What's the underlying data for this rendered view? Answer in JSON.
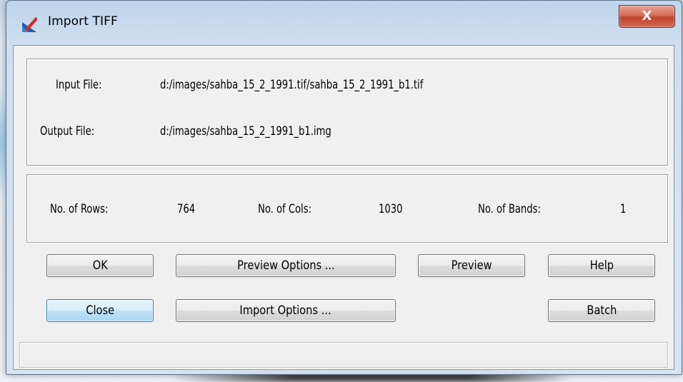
{
  "window": {
    "title": "Import TIFF",
    "close_glyph": "X",
    "icon": "erdas-app-icon"
  },
  "files": {
    "input_label": "Input File:",
    "input_value": "d:/images/sahba_15_2_1991.tif/sahba_15_2_1991_b1.tif",
    "output_label": "Output File:",
    "output_value": "d:/images/sahba_15_2_1991_b1.img"
  },
  "dimensions": {
    "rows_label": "No. of Rows:",
    "rows_value": "764",
    "cols_label": "No. of Cols:",
    "cols_value": "1030",
    "bands_label": "No. of Bands:",
    "bands_value": "1"
  },
  "buttons": {
    "ok": "OK",
    "preview_options": "Preview Options ...",
    "preview": "Preview",
    "help": "Help",
    "close": "Close",
    "import_options": "Import Options ...",
    "batch": "Batch"
  },
  "colors": {
    "close_button": "#c7452e",
    "focus_button": "#bfe1f6",
    "dialog_face": "#f0f0f0"
  }
}
